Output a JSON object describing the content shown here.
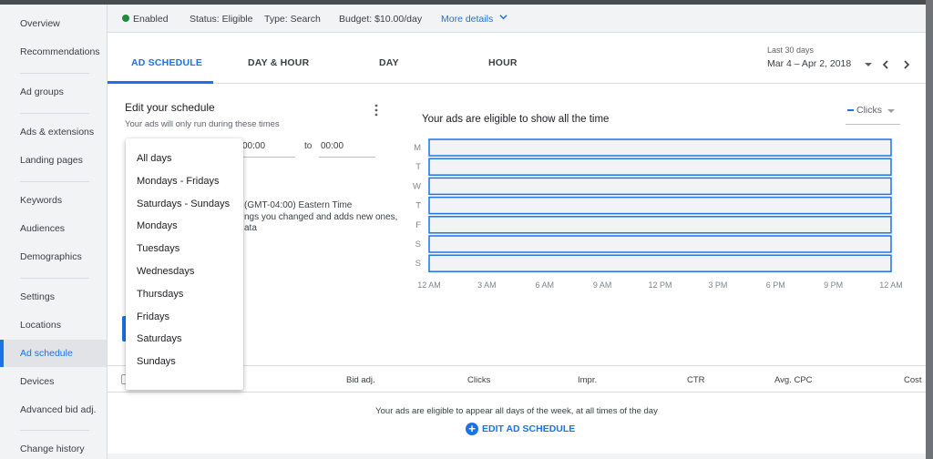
{
  "sidebar": {
    "items": [
      {
        "label": "Overview",
        "active": false
      },
      {
        "label": "Recommendations",
        "active": false
      },
      {
        "label": "Ad groups",
        "active": false
      },
      {
        "label": "Ads & extensions",
        "active": false
      },
      {
        "label": "Landing pages",
        "active": false
      },
      {
        "label": "Keywords",
        "active": false
      },
      {
        "label": "Audiences",
        "active": false
      },
      {
        "label": "Demographics",
        "active": false
      },
      {
        "label": "Settings",
        "active": false
      },
      {
        "label": "Locations",
        "active": false
      },
      {
        "label": "Ad schedule",
        "active": true
      },
      {
        "label": "Devices",
        "active": false
      },
      {
        "label": "Advanced bid adj.",
        "active": false
      },
      {
        "label": "Change history",
        "active": false
      }
    ]
  },
  "statusbar": {
    "enabled": "Enabled",
    "status": "Status: Eligible",
    "type": "Type: Search",
    "budget": "Budget: $10.00/day",
    "more": "More details"
  },
  "tabs": [
    {
      "label": "AD SCHEDULE",
      "active": true
    },
    {
      "label": "DAY & HOUR",
      "active": false
    },
    {
      "label": "DAY",
      "active": false
    },
    {
      "label": "HOUR",
      "active": false
    }
  ],
  "date_range": {
    "label": "Last 30 days",
    "value": "Mar 4 – Apr 2, 2018"
  },
  "editor": {
    "title": "Edit your schedule",
    "subtitle": "Your ads will only run during these times",
    "start_time": "00:00",
    "to": "to",
    "end_time": "00:00",
    "timezone_line1": "(GMT-04:00) Eastern Time",
    "timezone_line2": "ngs you changed and adds new ones,",
    "timezone_line3": "ata"
  },
  "day_dropdown": {
    "options": [
      "All days",
      "Mondays - Fridays",
      "Saturdays - Sundays",
      "Mondays",
      "Tuesdays",
      "Wednesdays",
      "Thursdays",
      "Fridays",
      "Saturdays",
      "Sundays"
    ]
  },
  "chart": {
    "title": "Your ads are eligible to show all the time",
    "metric": "Clicks"
  },
  "chart_data": {
    "type": "heatmap",
    "rows": [
      "M",
      "T",
      "W",
      "T",
      "F",
      "S",
      "S"
    ],
    "x_ticks": [
      "12 AM",
      "3 AM",
      "6 AM",
      "9 AM",
      "12 PM",
      "3 PM",
      "6 PM",
      "9 PM",
      "12 AM"
    ],
    "x_range": [
      0,
      24
    ],
    "scheduled": [
      [
        0,
        24
      ],
      [
        0,
        24
      ],
      [
        0,
        24
      ],
      [
        0,
        24
      ],
      [
        0,
        24
      ],
      [
        0,
        24
      ],
      [
        0,
        24
      ]
    ],
    "fill_color": "#f1f3f4",
    "border_color": "#1a73e8"
  },
  "table": {
    "headers": [
      "Bid adj.",
      "Clicks",
      "Impr.",
      "CTR",
      "Avg. CPC",
      "Cost"
    ],
    "empty_message": "Your ads are eligible to appear all days of the week, at all times of the day",
    "edit_link": "EDIT AD SCHEDULE"
  },
  "colors": {
    "accent": "#1a73e8",
    "enabled": "#1e8e3e"
  }
}
